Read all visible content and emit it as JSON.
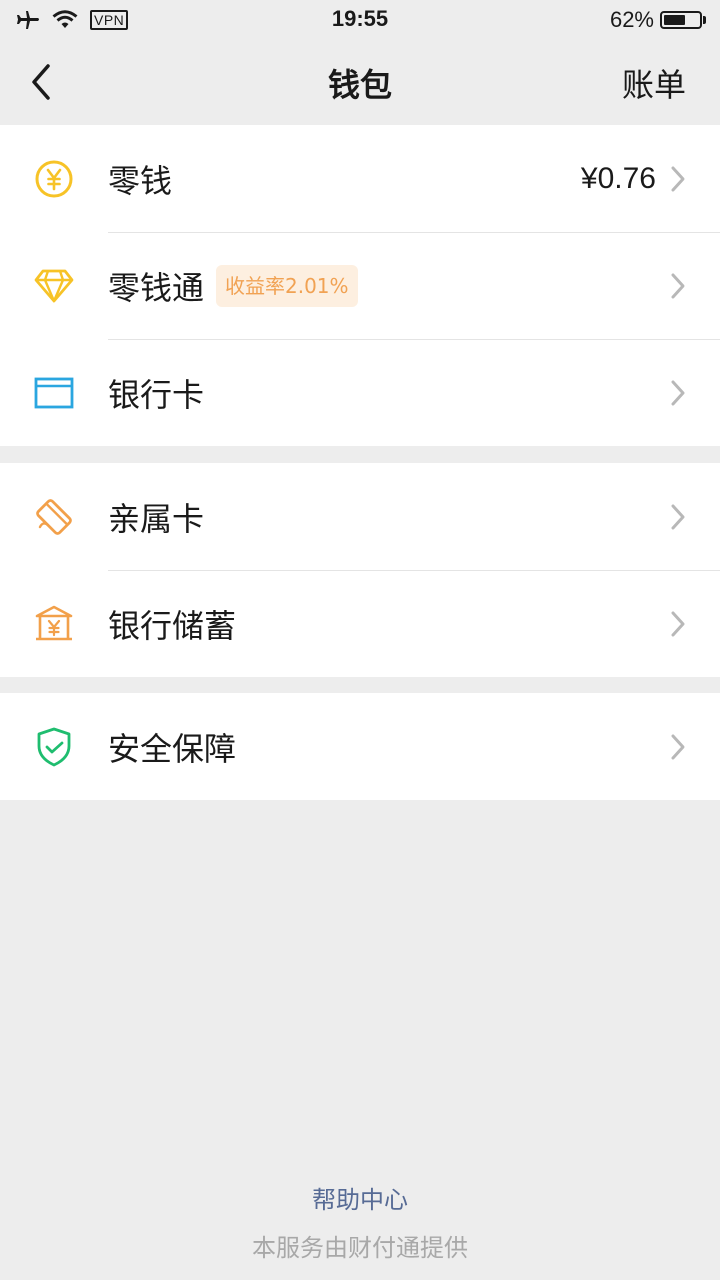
{
  "status_bar": {
    "vpn_label": "VPN",
    "time": "19:55",
    "battery_percent_text": "62%",
    "battery_level": 0.62
  },
  "nav": {
    "title": "钱包",
    "right_label": "账单"
  },
  "groups": [
    {
      "items": [
        {
          "label": "零钱",
          "value": "¥0.76",
          "icon": "yuan-coin-icon"
        },
        {
          "label": "零钱通",
          "badge": "收益率2.01%",
          "icon": "diamond-icon"
        },
        {
          "label": "银行卡",
          "icon": "bank-card-icon"
        }
      ]
    },
    {
      "items": [
        {
          "label": "亲属卡",
          "icon": "family-card-icon"
        },
        {
          "label": "银行储蓄",
          "icon": "bank-savings-icon"
        }
      ]
    },
    {
      "items": [
        {
          "label": "安全保障",
          "icon": "shield-check-icon"
        }
      ]
    }
  ],
  "footer": {
    "help_link": "帮助中心",
    "provider_note": "本服务由财付通提供"
  },
  "colors": {
    "background": "#ededed",
    "coin": "#f7c327",
    "diamond": "#f7c327",
    "card": "#2aa6e0",
    "family_card": "#f2a04a",
    "savings": "#f2a04a",
    "shield": "#1fbd6f",
    "badge_text": "#f1a253",
    "badge_bg": "#fdefe0",
    "link": "#576b95"
  }
}
